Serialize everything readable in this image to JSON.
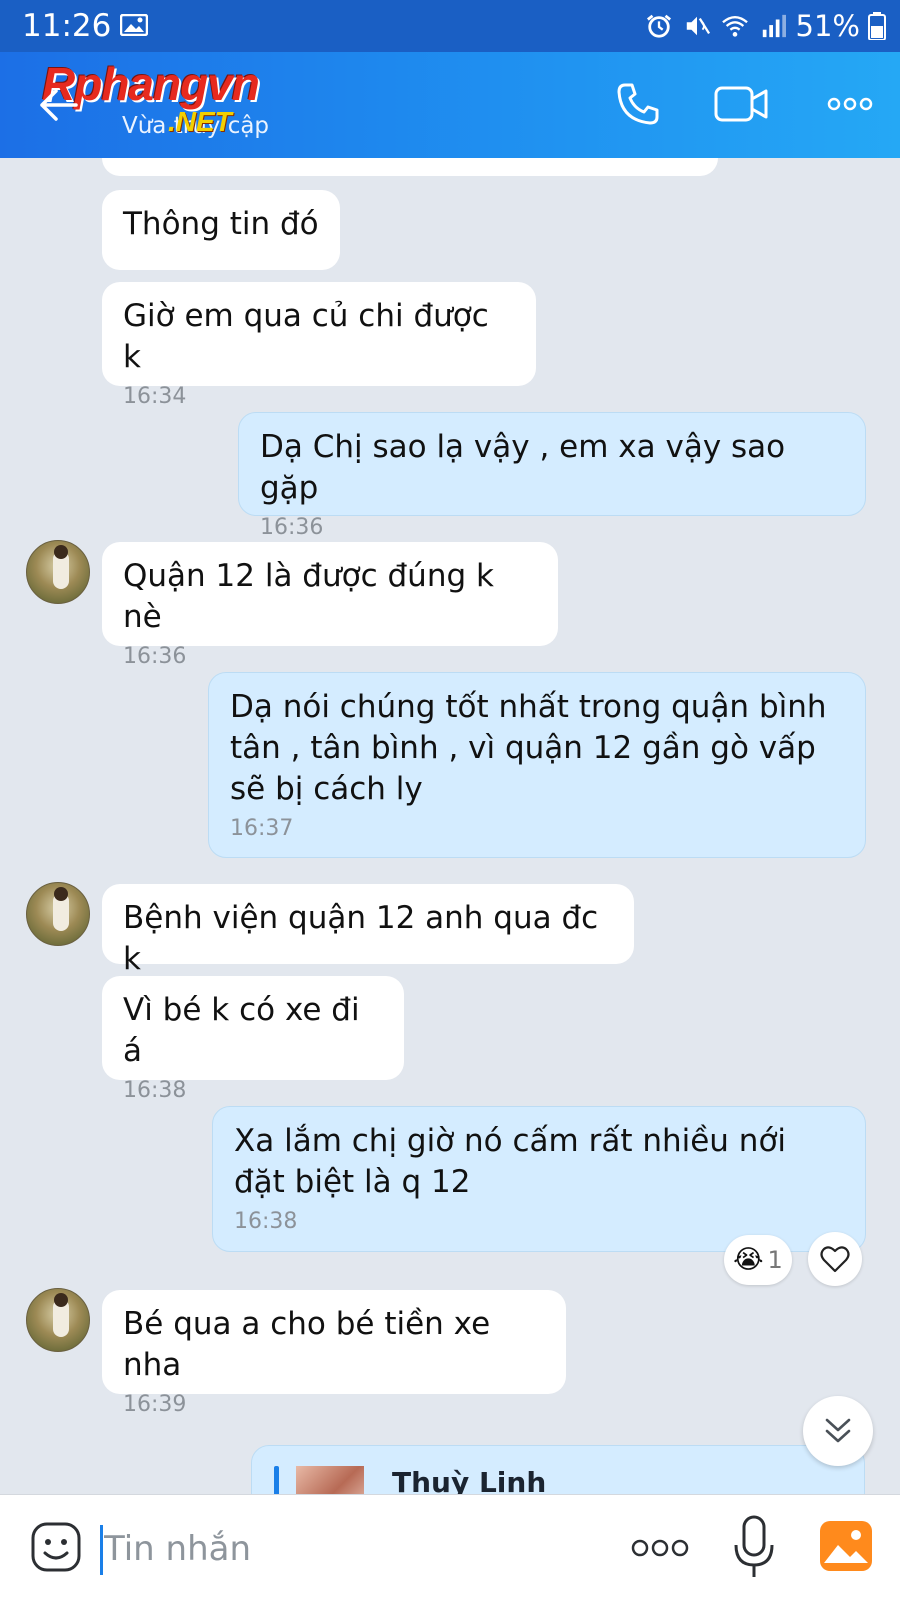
{
  "status_bar": {
    "time": "11:26",
    "battery_percent": "51%",
    "icons": [
      "gallery-icon",
      "alarm-icon",
      "mute-icon",
      "wifi-icon",
      "signal-icon",
      "battery-icon"
    ]
  },
  "header": {
    "logo_text": "Rphangvn",
    "logo_suffix": ".NET",
    "subtitle": "Vừa truy cập",
    "actions": [
      "phone-icon",
      "video-call-icon",
      "more-options-icon"
    ],
    "colors": {
      "gradient_start": "#1c6fe6",
      "gradient_end": "#25a8f5"
    }
  },
  "messages": [
    {
      "side": "in",
      "text": "Thông tin đó",
      "time": ""
    },
    {
      "side": "in",
      "text": "Giờ em qua củ chi được k",
      "time": "16:34"
    },
    {
      "side": "out",
      "text": "Dạ Chị sao lạ vậy , em xa vậy sao gặp",
      "time": "16:36"
    },
    {
      "side": "in",
      "text": "Quận 12 là được đúng k nè",
      "time": "16:36"
    },
    {
      "side": "out",
      "text": "Dạ nói chúng tốt nhất trong quận bình tân , tân bình , vì quận 12 gần gò vấp sẽ bị cách ly",
      "time": "16:37"
    },
    {
      "side": "in",
      "text": "Bệnh viện quận 12 anh qua đc k",
      "time": ""
    },
    {
      "side": "in",
      "text": "Vì bé k có xe đi á",
      "time": "16:38"
    },
    {
      "side": "out",
      "text": "Xa lắm chị giờ nó cấm rất nhiều nới đặt biệt là q 12",
      "time": "16:38"
    },
    {
      "side": "in",
      "text": "Bé qua a cho bé tiền xe nha",
      "time": "16:39"
    }
  ],
  "reaction": {
    "emoji": "😭",
    "count": "1"
  },
  "quoted_reply": {
    "sender": "Thuỳ Linh"
  },
  "input": {
    "placeholder": "Tin nhắn"
  },
  "theme": {
    "incoming_bubble": "#ffffff",
    "outgoing_bubble": "#d4ecff",
    "chat_background": "#e2e7ee"
  }
}
